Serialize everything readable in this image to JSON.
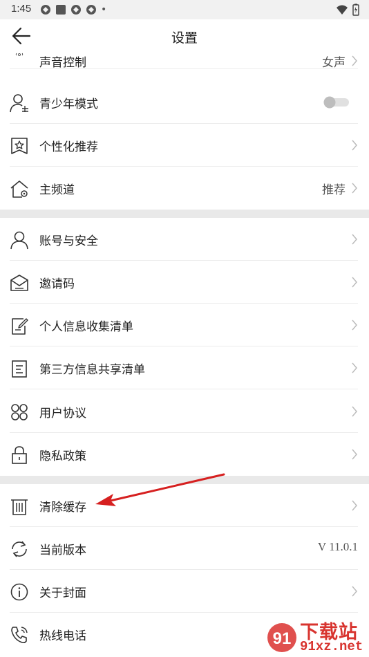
{
  "status_bar": {
    "time": "1:45",
    "dot": "•"
  },
  "header": {
    "title": "设置",
    "back_icon": "arrow-left-icon"
  },
  "section1": [
    {
      "label": "声音控制",
      "value": "女声",
      "icon": "voice-icon"
    },
    {
      "label": "青少年模式",
      "icon": "teen-icon",
      "toggle": false
    },
    {
      "label": "个性化推荐",
      "icon": "star-badge-icon"
    },
    {
      "label": "主频道",
      "value": "推荐",
      "icon": "home-gear-icon"
    }
  ],
  "section2": [
    {
      "label": "账号与安全",
      "icon": "user-icon"
    },
    {
      "label": "邀请码",
      "icon": "envelope-icon"
    },
    {
      "label": "个人信息收集清单",
      "icon": "document-edit-icon"
    },
    {
      "label": "第三方信息共享清单",
      "icon": "list-document-icon"
    },
    {
      "label": "用户协议",
      "icon": "clover-icon"
    },
    {
      "label": "隐私政策",
      "icon": "lock-icon"
    }
  ],
  "section3": [
    {
      "label": "清除缓存",
      "icon": "trash-icon"
    },
    {
      "label": "当前版本",
      "value": "V 11.0.1",
      "icon": "refresh-icon"
    },
    {
      "label": "关于封面",
      "icon": "info-icon"
    },
    {
      "label": "热线电话",
      "icon": "phone-icon"
    }
  ],
  "watermark": {
    "brand": "下载站",
    "url": "91xz.net"
  },
  "colors": {
    "annotation_arrow": "#d62020",
    "section_gap": "#e9e9e9",
    "toggle_off": "#bdbdbd"
  }
}
